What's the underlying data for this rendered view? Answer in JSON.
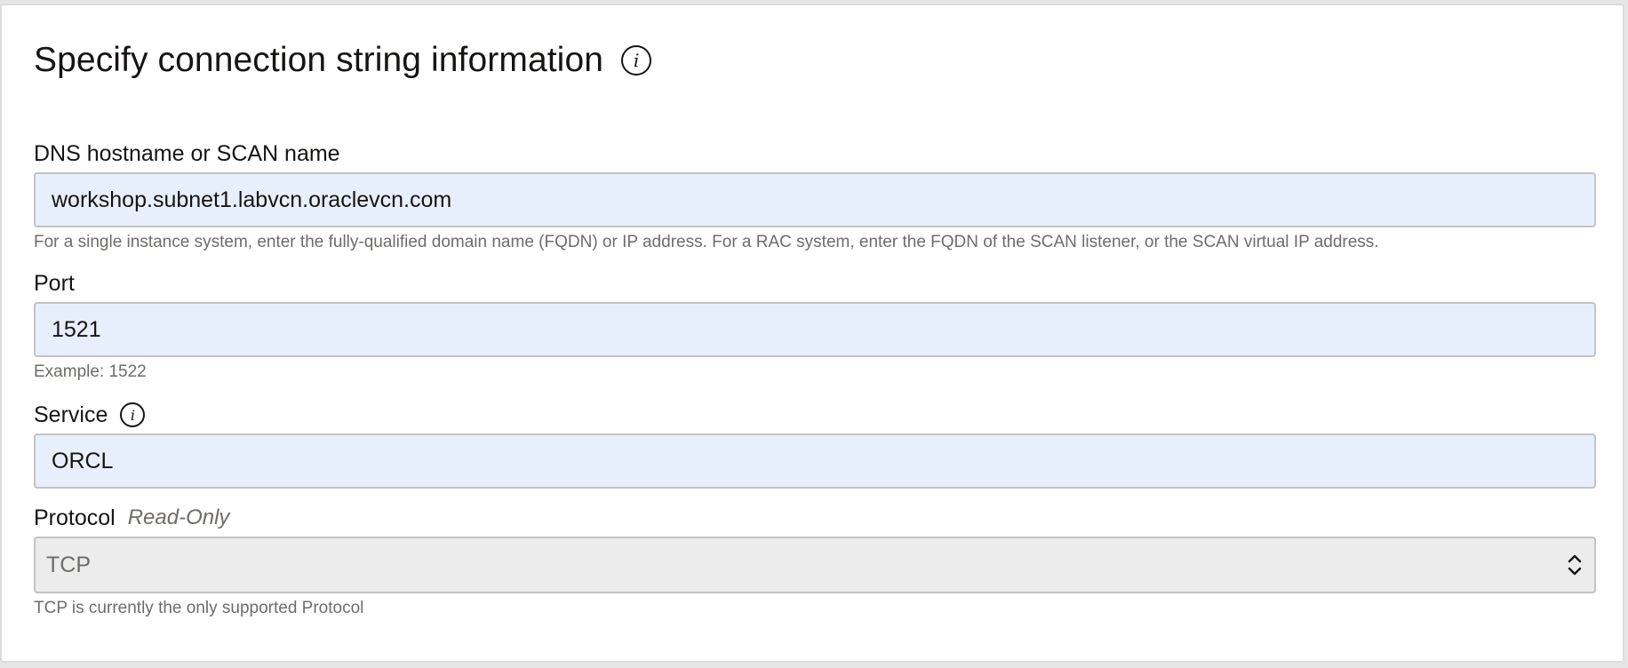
{
  "section": {
    "title": "Specify connection string information",
    "title_info_icon": "info-icon"
  },
  "fields": {
    "dns": {
      "label": "DNS hostname or SCAN name",
      "value": "workshop.subnet1.labvcn.oraclevcn.com",
      "help": "For a single instance system, enter the fully-qualified domain name (FQDN) or IP address. For a RAC system, enter the FQDN of the SCAN listener, or the SCAN virtual IP address."
    },
    "port": {
      "label": "Port",
      "value": "1521",
      "help": "Example: 1522"
    },
    "service": {
      "label": "Service",
      "value": "ORCL",
      "info_icon": "info-icon"
    },
    "protocol": {
      "label": "Protocol",
      "readonly_tag": "Read-Only",
      "value": "TCP",
      "help": "TCP is currently the only supported Protocol",
      "chevron_icon": "chevron-up-down-icon"
    }
  },
  "colors": {
    "input_background": "#e8effc",
    "readonly_background": "#ececec",
    "help_text": "#6f6c69"
  }
}
